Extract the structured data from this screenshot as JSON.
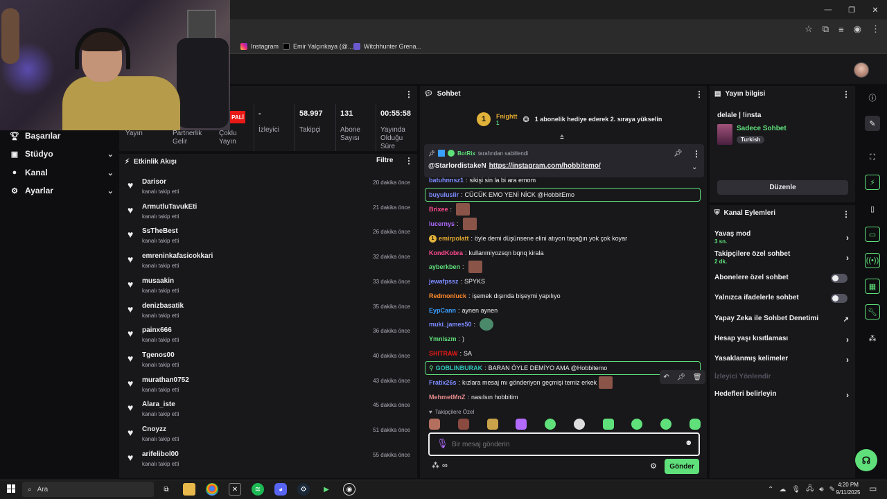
{
  "colors": {
    "accent": "#5fe07a",
    "background": "#0e0e10",
    "panel": "#18181b",
    "badge_red": "#e91916"
  },
  "browser": {
    "bookmarks": [
      {
        "label": "Instagram",
        "icon": "instagram-icon"
      },
      {
        "label": "Emir Yalçınkaya (@...",
        "icon": "x-icon"
      },
      {
        "label": "Witchhunter Grena...",
        "icon": "game-icon"
      }
    ]
  },
  "nav": {
    "items": [
      {
        "label": "Başarılar",
        "icon": "trophy-icon"
      },
      {
        "label": "Stüdyo",
        "icon": "video-icon"
      },
      {
        "label": "Kanal",
        "icon": "user-icon"
      },
      {
        "label": "Ayarlar",
        "icon": "gear-icon"
      }
    ]
  },
  "stats": {
    "partial_labels": [
      "Yayın",
      "Partnerlik Gelir",
      "Çoklu Yayın"
    ],
    "badge": "PALİ",
    "columns": [
      {
        "value": "-",
        "label": "İzleyici"
      },
      {
        "value": "58.997",
        "label": "Takipçi"
      },
      {
        "value": "131",
        "label": "Abone Sayısı"
      },
      {
        "value": "00:55:58",
        "label": "Yayında Olduğu Süre"
      }
    ]
  },
  "activity": {
    "title": "Etkinlik Akışı",
    "filter_label": "Filtre",
    "items": [
      {
        "name": "Darisor",
        "action": "kanalı takip etti",
        "time": "20 dakika önce"
      },
      {
        "name": "ArmutluTavukEti",
        "action": "kanalı takip etti",
        "time": "21 dakika önce"
      },
      {
        "name": "SsTheBest",
        "action": "kanalı takip etti",
        "time": "26 dakika önce"
      },
      {
        "name": "emreninkafasicokkari",
        "action": "kanalı takip etti",
        "time": "32 dakika önce"
      },
      {
        "name": "musaakin",
        "action": "kanalı takip etti",
        "time": "33 dakika önce"
      },
      {
        "name": "denizbasatik",
        "action": "kanalı takip etti",
        "time": "35 dakika önce"
      },
      {
        "name": "painx666",
        "action": "kanalı takip etti",
        "time": "36 dakika önce"
      },
      {
        "name": "Tgenos00",
        "action": "kanalı takip etti",
        "time": "40 dakika önce"
      },
      {
        "name": "murathan0752",
        "action": "kanalı takip etti",
        "time": "43 dakika önce"
      },
      {
        "name": "Alara_iste",
        "action": "kanalı takip etti",
        "time": "45 dakika önce"
      },
      {
        "name": "Cnoyzz",
        "action": "kanalı takip etti",
        "time": "51 dakika önce"
      },
      {
        "name": "arifelibol00",
        "action": "kanalı takip etti",
        "time": "55 dakika önce"
      }
    ]
  },
  "chat": {
    "title": "Sohbet",
    "hype": {
      "rank": "1",
      "user": "Fnightt",
      "count": "1",
      "text": "1 abonelik hediye ederek 2. sıraya yükselin"
    },
    "pinned": {
      "bot": "BotRix",
      "pinned_by": "tarafından sabitlendi",
      "mention": "@StarlordistakeN",
      "link": "https://instagram.com/hobbitemo/"
    },
    "messages": [
      {
        "user": "batuhnnsz1",
        "text": "sikişi sin la bi ara emom",
        "color": "#7d8cff"
      },
      {
        "user": "buyulusiir",
        "text": "CÜCÜK EMO YENİ NİCK @HobbitEmo",
        "color": "#7d8cff"
      },
      {
        "user": "Brixee",
        "text": "",
        "color": "#ff4a8d",
        "emote": true
      },
      {
        "user": "lucernys",
        "text": "",
        "color": "#b36bff",
        "emote": true
      },
      {
        "user": "emirpolatt",
        "text": "öyle demi düşünsene elini atıyon taşağın yok çok koyar",
        "color": "#e3a92f"
      },
      {
        "user": "KondKobra",
        "text": "kullanmiyozsqn bqnq kirala",
        "color": "#ff4a8d"
      },
      {
        "user": "ayberkben",
        "text": "",
        "color": "#5fe07a",
        "emote": true
      },
      {
        "user": "jewafpssz",
        "text": "SPYKS",
        "color": "#7d8cff"
      },
      {
        "user": "Redmonluck",
        "text": "işemek dışında bişeymi yapılıyo",
        "color": "#ff8a2a"
      },
      {
        "user": "EypCann",
        "text": "aynen aynen",
        "color": "#3aa0ff"
      },
      {
        "user": "muki_james50",
        "text": "",
        "color": "#7d8cff",
        "emote": true
      },
      {
        "user": "Ymniszm",
        "text": ")",
        "color": "#5fe07a"
      },
      {
        "user": "SHITRAW",
        "text": "SA",
        "color": "#e91916"
      },
      {
        "user": "GOBLINBURAK",
        "text": "BARAN ÖYLE DEMİYO AMA @Hobbitemo",
        "color": "#2ec4b6"
      },
      {
        "user": "Fratix26s",
        "text": "kızlara mesaj mı gönderiyon geçmişi temiz erkek",
        "color": "#7d8cff",
        "emote": true
      },
      {
        "user": "MehmetMnZ",
        "text": "nasılsın hobbitim",
        "color": "#e38a8a"
      }
    ],
    "followers_only_label": "Takipçilere Özel",
    "input_placeholder": "Bir mesaj gönderin",
    "send_label": "Gönder",
    "infinity": "∞"
  },
  "stream_info": {
    "title": "Yayın bilgisi",
    "stream_title": "delale | !insta",
    "category": "Sadece Sohbet",
    "language": "Turkish",
    "edit_label": "Düzenle"
  },
  "channel_actions": {
    "title": "Kanal Eylemleri",
    "items": [
      {
        "label": "Yavaş mod",
        "sub": "3 sn.",
        "kind": "chevron"
      },
      {
        "label": "Takipçilere özel sohbet",
        "sub": "2 dk.",
        "kind": "chevron"
      },
      {
        "label": "Abonelere özel sohbet",
        "sub": "",
        "kind": "toggle"
      },
      {
        "label": "Yalnızca ifadelerle sohbet",
        "sub": "",
        "kind": "toggle"
      },
      {
        "label": "Yapay Zeka ile Sohbet Denetimi",
        "sub": "",
        "kind": "external"
      },
      {
        "label": "Hesap yaşı kısıtlaması",
        "sub": "",
        "kind": "chevron"
      },
      {
        "label": "Yasaklanmış kelimeler",
        "sub": "",
        "kind": "chevron"
      },
      {
        "label": "İzleyici Yönlendir",
        "sub": "",
        "kind": "disabled"
      },
      {
        "label": "Hedefleri belirleyin",
        "sub": "",
        "kind": "chevron"
      }
    ]
  },
  "taskbar": {
    "search_placeholder": "Ara",
    "time": "4:20 PM",
    "date": "9/11/2025"
  }
}
